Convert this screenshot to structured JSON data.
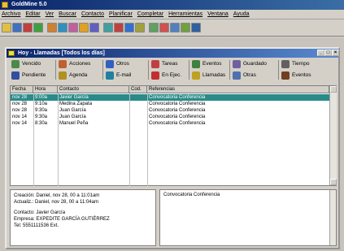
{
  "app": {
    "title": "GoldMine 5.0",
    "menu": [
      "Archivo",
      "Editar",
      "Ver",
      "Buscar",
      "Contacto",
      "Planificar",
      "Completar",
      "Herramientas",
      "Ventana",
      "Ayuda"
    ]
  },
  "toolbar": {
    "buttons": [
      "new",
      "open",
      "print",
      "lookup",
      "contacts",
      "calendar",
      "activity",
      "email",
      "report",
      "schedule",
      "complete",
      "web",
      "phone",
      "notes",
      "tasks",
      "forecast",
      "sync",
      "help"
    ]
  },
  "window": {
    "title": "Hoy - Llamadas  [Todos los días]"
  },
  "nav": {
    "row1": [
      {
        "label": "Vencido",
        "icon": "vencido-icon",
        "color": "#4a8a4a"
      },
      {
        "label": "Acciones",
        "icon": "acciones-icon",
        "color": "#c06030"
      },
      {
        "label": "Otros",
        "icon": "otros-icon",
        "color": "#3060c0"
      },
      {
        "label": "Tareas",
        "icon": "tareas-icon",
        "color": "#c04040"
      },
      {
        "label": "Eventos",
        "icon": "eventos-icon",
        "color": "#408040"
      },
      {
        "label": "Guardado",
        "icon": "guardado-icon",
        "color": "#7060a0"
      },
      {
        "label": "Tiempo",
        "icon": "tiempo-icon",
        "color": "#606060"
      }
    ],
    "row2": [
      {
        "label": "Pendiente",
        "icon": "pendiente-icon",
        "color": "#3050a0"
      },
      {
        "label": "Agenda",
        "icon": "agenda-icon",
        "color": "#b09020"
      },
      {
        "label": "E-mail",
        "icon": "email-icon",
        "color": "#2080a0"
      },
      {
        "label": "En Ejec.",
        "icon": "ejecucion-icon",
        "color": "#c03030"
      },
      {
        "label": "Llamadas",
        "icon": "llamadas-icon",
        "color": "#c0a020"
      },
      {
        "label": "Otras",
        "icon": "otras-icon",
        "color": "#5070b0"
      },
      {
        "label": "Eventos",
        "icon": "eventos2-icon",
        "color": "#704020"
      }
    ]
  },
  "grid": {
    "columns": [
      "Fecha",
      "Hora",
      "Contacto",
      "Cod.",
      "Referencias"
    ],
    "rows": [
      {
        "fecha": "nov 28",
        "hora": "9:00a",
        "contacto": "Javier García",
        "cod": "",
        "ref": "Convocatoria Conferencia",
        "selected": true
      },
      {
        "fecha": "nov 28",
        "hora": "9:10a",
        "contacto": "Medina Zapata",
        "cod": "",
        "ref": "Convocatoria Conferencia",
        "selected": false
      },
      {
        "fecha": "nov 28",
        "hora": "9:30a",
        "contacto": "Juan García",
        "cod": "",
        "ref": "Convocatoria Conferencia",
        "selected": false
      },
      {
        "fecha": "nov 14",
        "hora": "9:30a",
        "contacto": "Juan García",
        "cod": "",
        "ref": "Convocatoria Conferencia",
        "selected": false
      },
      {
        "fecha": "nov 14",
        "hora": "8:30a",
        "contacto": "Manuel Peña",
        "cod": "",
        "ref": "Convocatoria Conferencia",
        "selected": false
      }
    ]
  },
  "detail": {
    "creacion": "Creación: Daniel, nov 28, 00 a 11:01am",
    "actualiz": "Actualiz.: Daniel, nov 28, 00 a 11:04am",
    "contacto": "Contacto: Javier García",
    "empresa": "Empresa: EXPEDITE GARCÍA GUTIÉRREZ",
    "tel": "Tel: 5551111536  Ext.",
    "notes": "Convocatoria Conferencia"
  }
}
